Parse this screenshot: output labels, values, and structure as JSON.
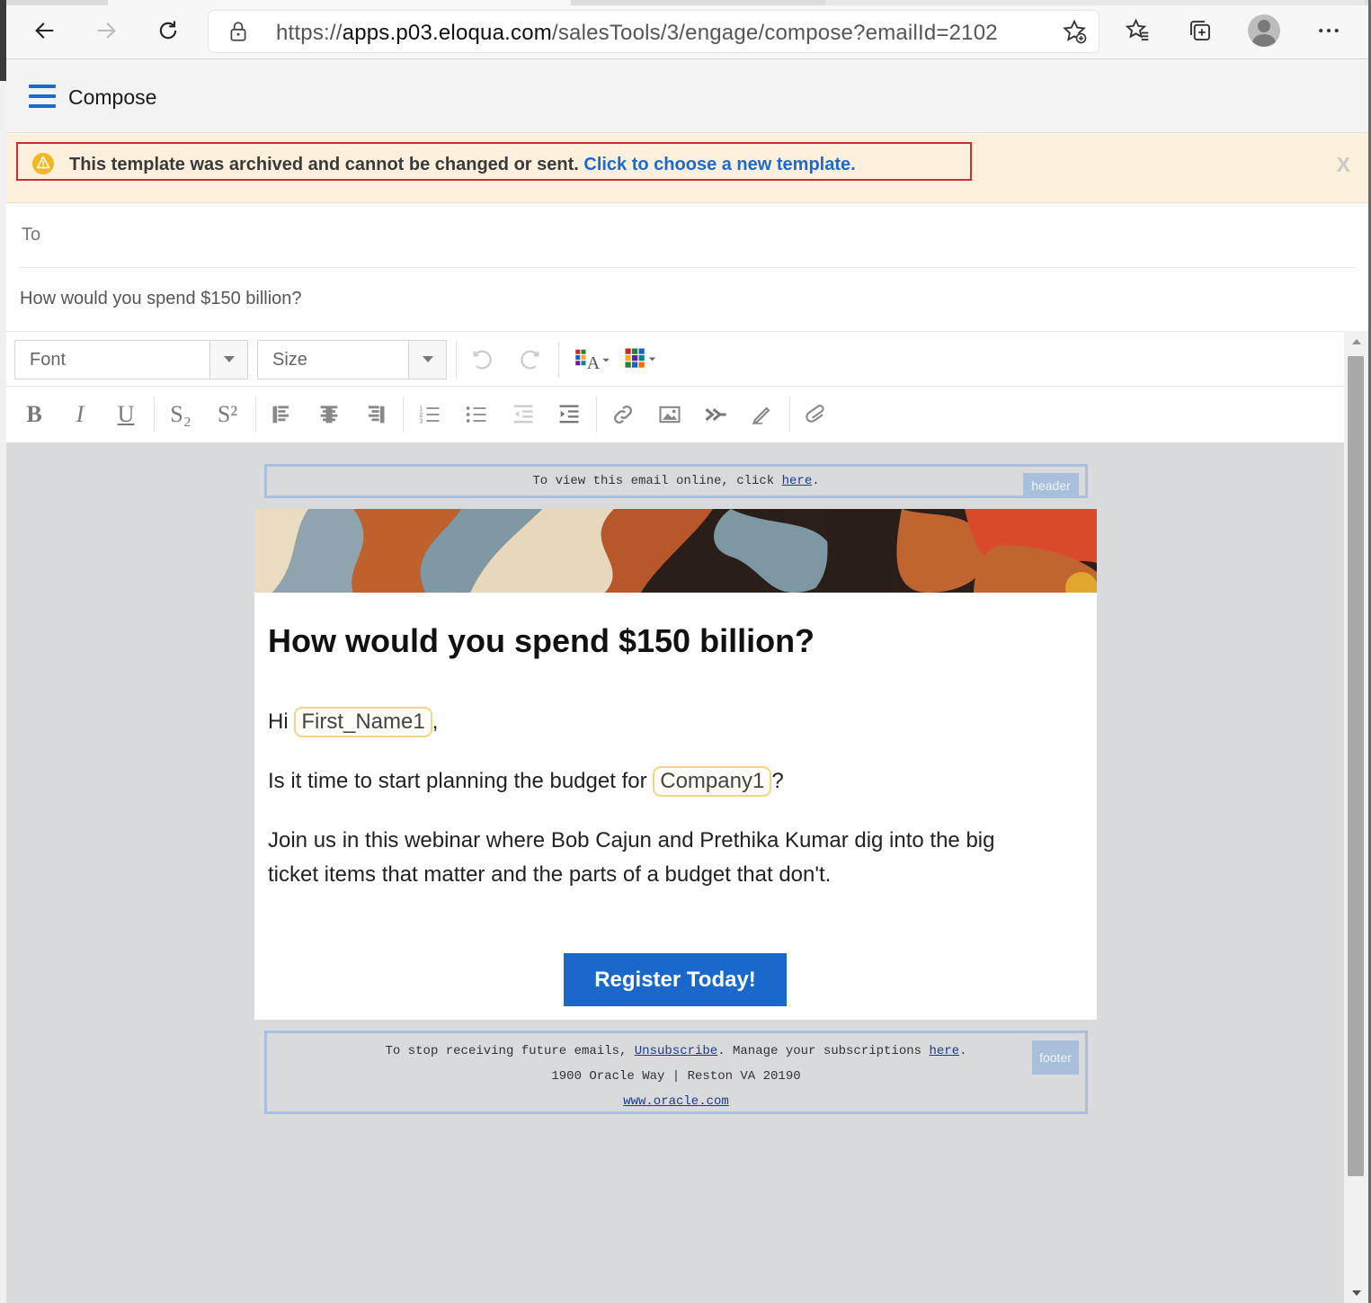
{
  "browser": {
    "url_prefix": "https://",
    "url_host": "apps.p03.eloqua.com",
    "url_path": "/salesTools/3/engage/compose?emailId=2102"
  },
  "app": {
    "title": "Compose"
  },
  "banner": {
    "message": "This template was archived and cannot be changed or sent.",
    "link": "Click to choose a new template.",
    "close": "X"
  },
  "compose": {
    "to_label": "To",
    "subject": "How would you spend $150 billion?"
  },
  "toolbar": {
    "font_placeholder": "Font",
    "size_placeholder": "Size",
    "bold": "B",
    "italic": "I",
    "underline": "U",
    "subscript": "S₂",
    "superscript": "S²"
  },
  "email": {
    "header_text": "To view this email online, click",
    "header_link": "here",
    "header_tag": "header",
    "title": "How would you spend $150 billion?",
    "greeting_prefix": "Hi",
    "greeting_field": "First_Name1",
    "greeting_suffix": ",",
    "budget_prefix": "Is it time to start planning the budget for",
    "budget_field": "Company1",
    "budget_suffix": "?",
    "webinar_text": "Join us in this webinar where Bob Cajun and Prethika Kumar dig into the big ticket items that matter and the parts of a budget that don't.",
    "cta_label": "Register Today!",
    "footer_line1_prefix": "To stop receiving future emails,",
    "footer_unsubscribe": "Unsubscribe",
    "footer_line1_mid": ".  Manage your subscriptions",
    "footer_manage_link": "here",
    "footer_address": "1900 Oracle Way | Reston VA 20190",
    "footer_site": "www.oracle.com",
    "footer_tag": "footer"
  },
  "colors": {
    "accent": "#1b6ad0",
    "banner_bg": "#fdf0dc",
    "banner_border": "#c9302c",
    "cta": "#1b68cd",
    "canvas_bg": "#d9dadc",
    "region_border": "#a9c0dc",
    "field_chip_border": "#f0d48a"
  }
}
